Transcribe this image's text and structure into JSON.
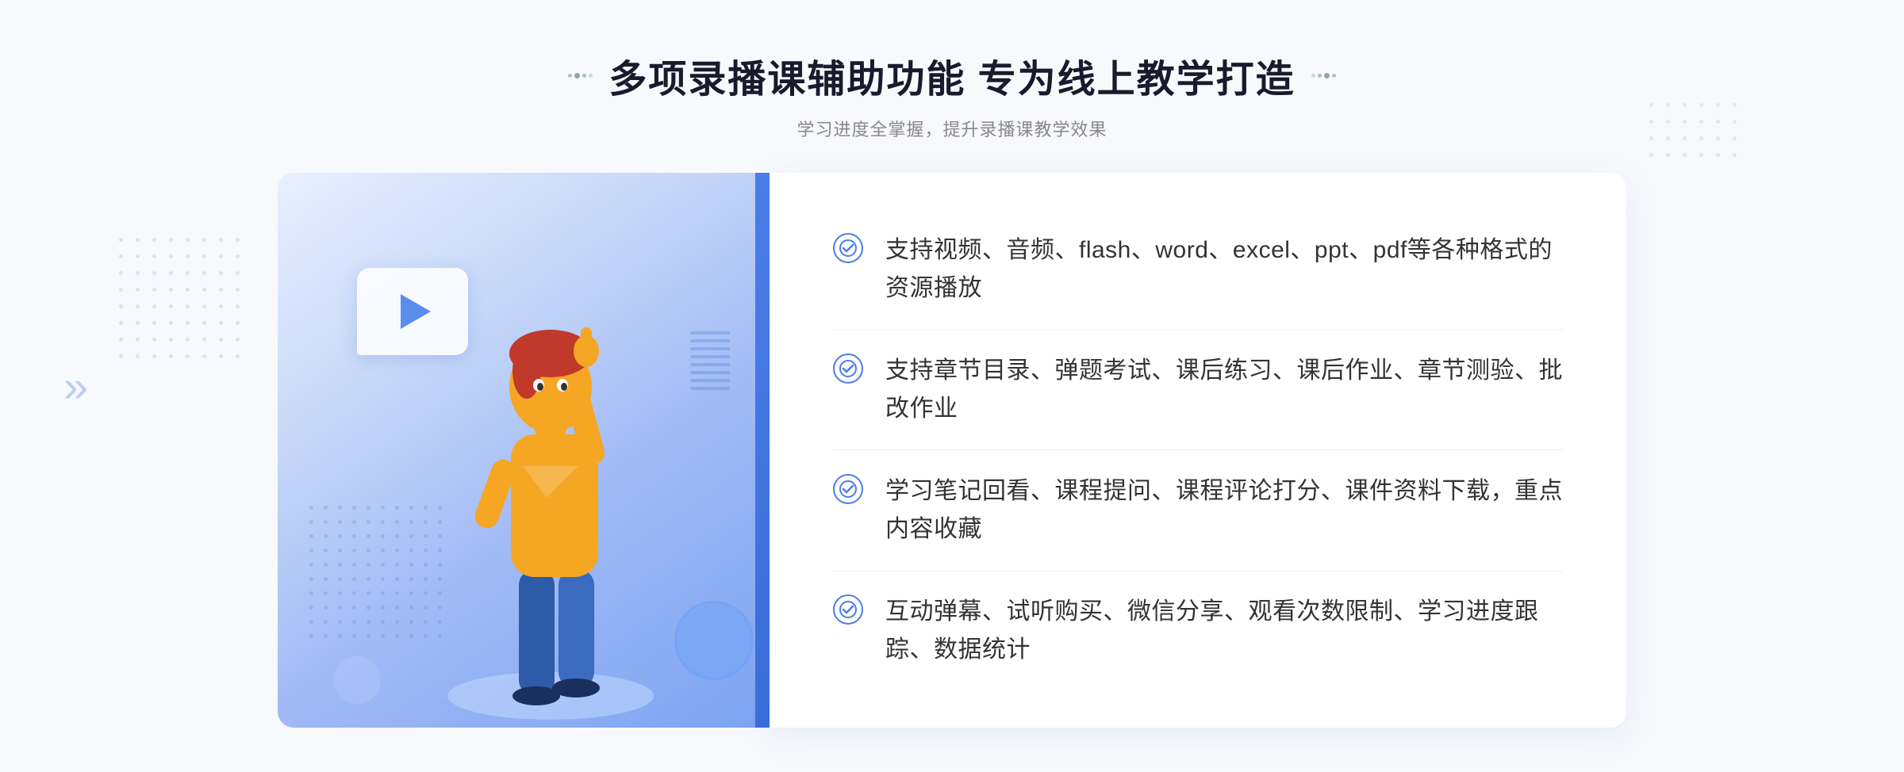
{
  "page": {
    "background": "#f8f9fc"
  },
  "header": {
    "main_title": "多项录播课辅助功能 专为线上教学打造",
    "sub_title": "学习进度全掌握，提升录播课教学效果"
  },
  "features": [
    {
      "id": 1,
      "text": "支持视频、音频、flash、word、excel、ppt、pdf等各种格式的资源播放"
    },
    {
      "id": 2,
      "text": "支持章节目录、弹题考试、课后练习、课后作业、章节测验、批改作业"
    },
    {
      "id": 3,
      "text": "学习笔记回看、课程提问、课程评论打分、课件资料下载，重点内容收藏"
    },
    {
      "id": 4,
      "text": "互动弹幕、试听购买、微信分享、观看次数限制、学习进度跟踪、数据统计"
    }
  ],
  "decorations": {
    "chevron_left": "»",
    "chevron_right": "«",
    "play_button": "▶"
  }
}
